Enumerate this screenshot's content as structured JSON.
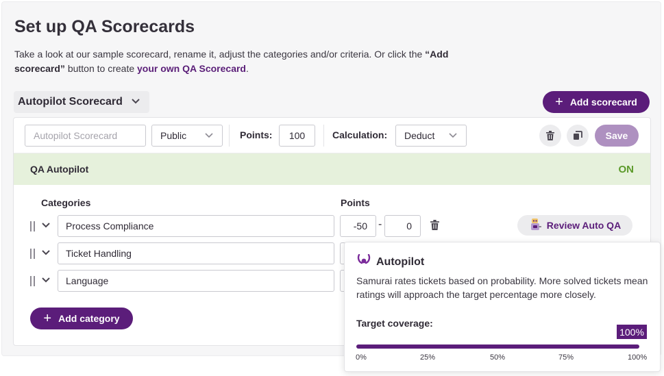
{
  "page": {
    "title": "Set up QA Scorecards",
    "intro_part1": "Take a look at our sample scorecard, rename it, adjust the categories and/or criteria. Or click the ",
    "intro_bold": "“Add scorecard”",
    "intro_part2": " button to create ",
    "intro_link": "your own QA Scorecard",
    "intro_end": "."
  },
  "scorecard_selector": {
    "label": "Autopilot Scorecard"
  },
  "add_scorecard": {
    "label": "Add scorecard"
  },
  "toolbar": {
    "name_placeholder": "Autopilot Scorecard",
    "visibility": "Public",
    "points_label": "Points:",
    "points_value": "100",
    "calculation_label": "Calculation:",
    "calculation_value": "Deduct",
    "save_label": "Save"
  },
  "banner": {
    "label": "QA Autopilot",
    "status": "ON"
  },
  "columns": {
    "categories": "Categories",
    "points": "Points"
  },
  "categories": [
    {
      "name": "Process Compliance",
      "min": "-50",
      "max": "0",
      "review_label": "Review Auto QA"
    },
    {
      "name": "Ticket Handling",
      "min": "",
      "max": ""
    },
    {
      "name": "Language",
      "min": "",
      "max": ""
    }
  ],
  "add_category": {
    "label": "Add category"
  },
  "popover": {
    "title": "Autopilot",
    "description": "Samurai rates tickets based on probability. More solved tickets mean ratings will approach the target percentage more closely.",
    "target_label": "Target coverage:",
    "target_value": "100%",
    "target_fraction": 1.0,
    "ticks": [
      "0%",
      "25%",
      "50%",
      "75%",
      "100%"
    ]
  },
  "colors": {
    "brand": "#5b1d7a",
    "save_disabled": "#ae90c0",
    "on_green": "#5c9a2a",
    "banner_bg": "#e6f1dc"
  }
}
